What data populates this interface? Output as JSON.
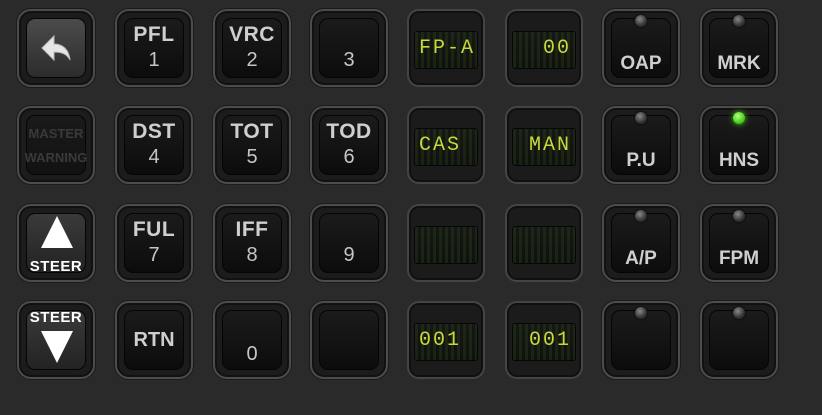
{
  "row1": {
    "back_icon": "back-arrow-icon",
    "pfl": {
      "label": "PFL",
      "digit": "1"
    },
    "vrc": {
      "label": "VRC",
      "digit": "2"
    },
    "key3": {
      "digit": "3"
    },
    "display1": {
      "text": "FP-A"
    },
    "display2": {
      "text": "00"
    },
    "oap": {
      "label": "OAP"
    },
    "mrk": {
      "label": "MRK"
    }
  },
  "row2": {
    "master_warning": {
      "line1": "MASTER",
      "line2": "WARNING"
    },
    "dst": {
      "label": "DST",
      "digit": "4"
    },
    "tot": {
      "label": "TOT",
      "digit": "5"
    },
    "tod": {
      "label": "TOD",
      "digit": "6"
    },
    "display1": {
      "text": "CAS"
    },
    "display2": {
      "text": "MAN"
    },
    "pu": {
      "label": "P.U"
    },
    "hns": {
      "label": "HNS",
      "led_color": "#4fd51c"
    }
  },
  "row3": {
    "steer_up": {
      "label": "STEER"
    },
    "ful": {
      "label": "FUL",
      "digit": "7"
    },
    "iff": {
      "label": "IFF",
      "digit": "8"
    },
    "key9": {
      "digit": "9"
    },
    "display1": {
      "text": ""
    },
    "display2": {
      "text": ""
    },
    "ap": {
      "label": "A/P"
    },
    "fpm": {
      "label": "FPM"
    }
  },
  "row4": {
    "steer_down": {
      "label": "STEER"
    },
    "rtn": {
      "label": "RTN"
    },
    "key0": {
      "digit": "0"
    },
    "display1": {
      "text": "001"
    },
    "display2": {
      "text": "001"
    }
  },
  "colors": {
    "display_text": "#c7d93a",
    "led_on": "#4fd51c",
    "label": "#cfcfcf"
  }
}
